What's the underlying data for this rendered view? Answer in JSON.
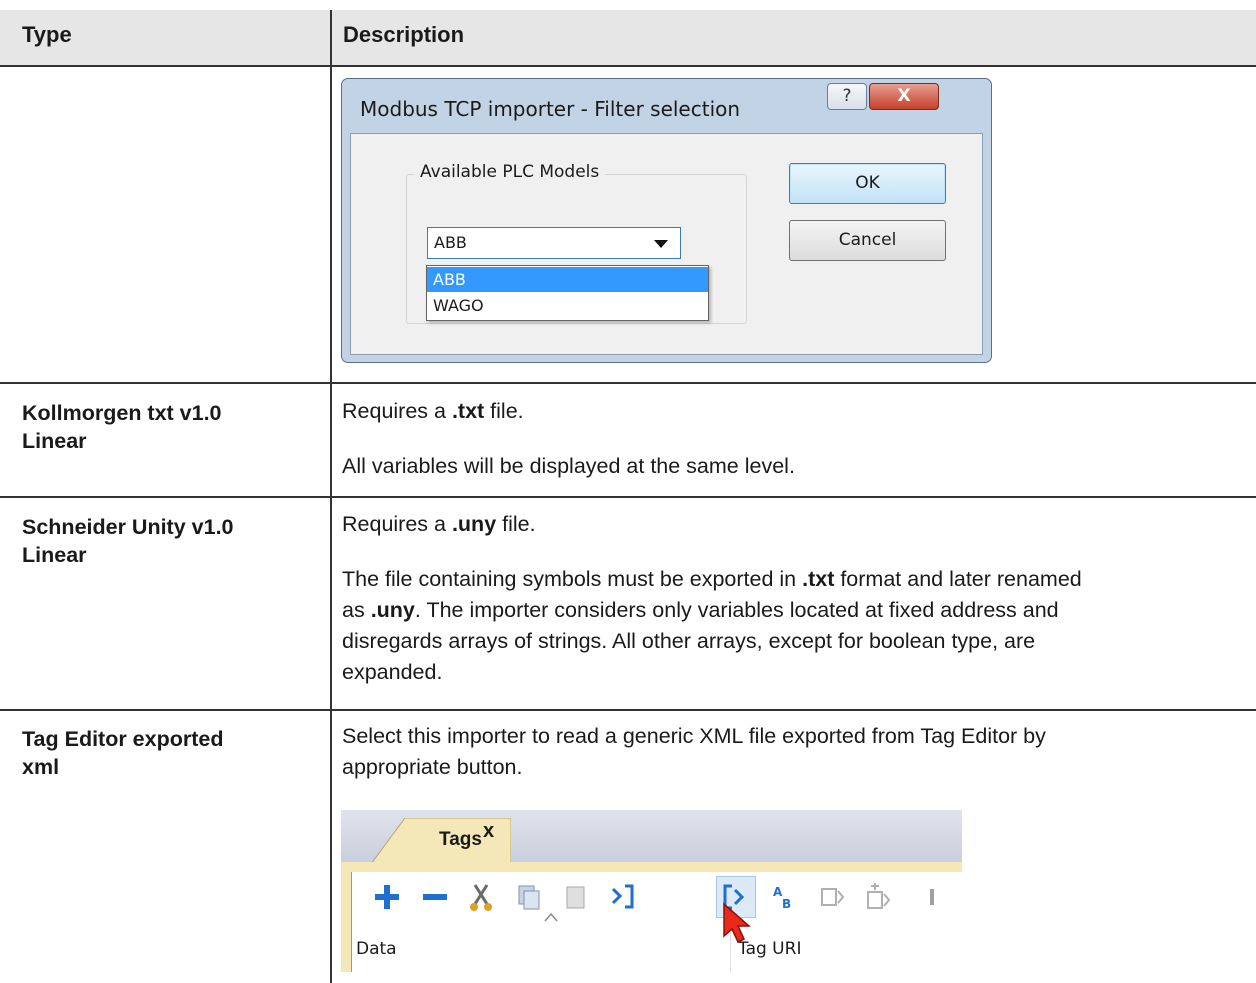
{
  "table": {
    "headers": {
      "type": "Type",
      "description": "Description"
    },
    "rows": [
      {
        "type": "",
        "dialog": {
          "title": "Modbus TCP importer - Filter selection",
          "help_label": "?",
          "close_label": "X",
          "group_label": "Available PLC Models",
          "combo_value": "ABB",
          "options": [
            "ABB",
            "WAGO"
          ],
          "ok_label": "OK",
          "cancel_label": "Cancel"
        }
      },
      {
        "type_line1": "Kollmorgen txt v1.0",
        "type_line2": "Linear",
        "p1_pre": "Requires a ",
        "p1_bold": ".txt",
        "p1_post": " file.",
        "p2": "All variables will be displayed at the same level."
      },
      {
        "type_line1": "Schneider Unity v1.0",
        "type_line2": "Linear",
        "p1_pre": "Requires a ",
        "p1_bold": ".uny",
        "p1_post": " file.",
        "p2_a": "The file containing symbols must be exported in ",
        "p2_b": ".txt",
        "p2_c": " format and later renamed",
        "p2_d": "as ",
        "p2_e": ".uny",
        "p2_f": ". The importer considers only variables located at fixed address and",
        "p2_line3": "disregards arrays of strings. All other arrays, except for boolean type, are",
        "p2_line4": "expanded."
      },
      {
        "type_line1": "Tag Editor exported",
        "type_line2": "xml",
        "p1_line1": "Select this importer to read a generic XML file exported from Tag Editor by",
        "p1_line2": "appropriate button.",
        "tags_panel": {
          "tab_label": "Tags",
          "tab_close": "x",
          "column_data": "Data",
          "column_uri": "Tag URI"
        }
      }
    ]
  },
  "colors": {
    "header_bg": "#e6e6e6",
    "rule": "#333333",
    "selection_blue": "#3399ff",
    "toolbar_plus_blue": "#1e6fd0",
    "panel_gold": "#f4e8b8"
  },
  "icons": [
    "help-icon",
    "close-icon",
    "dropdown-arrow-icon",
    "add-icon",
    "remove-icon",
    "cut-icon",
    "copy-icon",
    "paste-icon",
    "export-icon",
    "import-icon",
    "find-replace-icon",
    "tag-icon",
    "tag-add-icon",
    "mouse-cursor-icon"
  ]
}
